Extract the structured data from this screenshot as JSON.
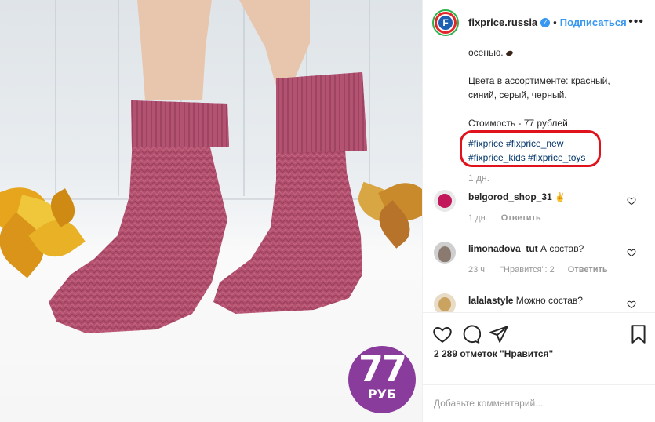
{
  "post": {
    "image_alt": "Розовые носки на ногах",
    "price": {
      "amount": "77",
      "currency": "РУБ"
    }
  },
  "header": {
    "username": "fixprice.russia",
    "separator": "•",
    "follow_label": "Подписаться",
    "more_label": "•••"
  },
  "caption": {
    "lines": [
      "осенью.",
      "",
      "Цвета в ассортименте: красный,",
      "синий, серый, черный.",
      "",
      "Стоимость - 77 рублей."
    ],
    "tags_line1": "#fixprice #fixprice_new",
    "tags_line2": "#fixprice_kids #fixprice_toys",
    "time": "1 дн."
  },
  "comments": [
    {
      "username": "belgorod_shop_31",
      "text": "",
      "time": "1 дн.",
      "likes": "",
      "reply": "Ответить"
    },
    {
      "username": "limonadova_tut",
      "text": "А состав?",
      "time": "23 ч.",
      "likes": "\"Нравится\": 2",
      "reply": "Ответить"
    },
    {
      "username": "lalalastyle",
      "text": "Можно состав?",
      "time": "",
      "likes": "",
      "reply": ""
    }
  ],
  "actions": {
    "likes_text": "2 289 отметок \"Нравится\"",
    "add_comment_placeholder": "Добавьте комментарий..."
  },
  "colors": {
    "accent_blue": "#3897f0",
    "hashtag": "#003569",
    "highlight_red": "#e0131d",
    "price_badge": "#8a3c9c",
    "sock": "#b3506e"
  }
}
